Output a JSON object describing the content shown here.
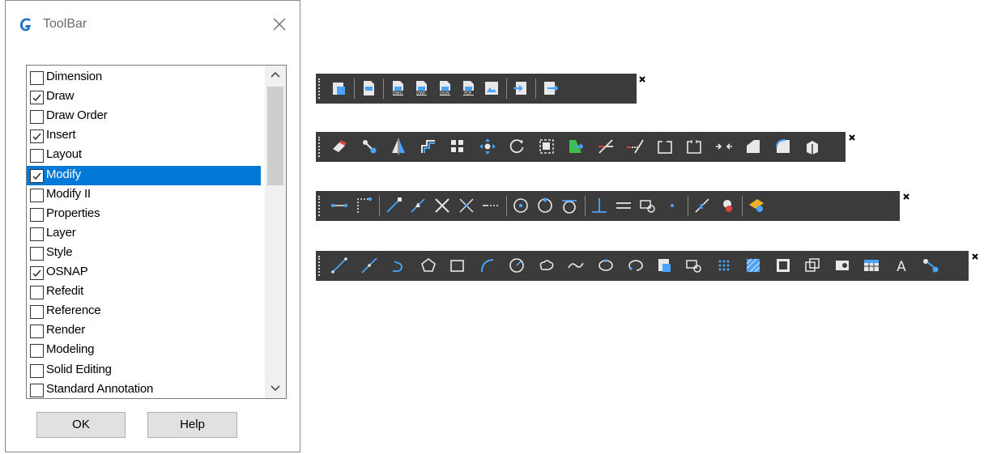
{
  "dialog": {
    "title": "ToolBar",
    "ok_label": "OK",
    "help_label": "Help",
    "items": [
      {
        "label": "Dimension",
        "checked": false,
        "selected": false
      },
      {
        "label": "Draw",
        "checked": true,
        "selected": false
      },
      {
        "label": "Draw Order",
        "checked": false,
        "selected": false
      },
      {
        "label": "Insert",
        "checked": true,
        "selected": false
      },
      {
        "label": "Layout",
        "checked": false,
        "selected": false
      },
      {
        "label": "Modify",
        "checked": true,
        "selected": true
      },
      {
        "label": "Modify II",
        "checked": false,
        "selected": false
      },
      {
        "label": "Properties",
        "checked": false,
        "selected": false
      },
      {
        "label": "Layer",
        "checked": false,
        "selected": false
      },
      {
        "label": "Style",
        "checked": false,
        "selected": false
      },
      {
        "label": "OSNAP",
        "checked": true,
        "selected": false
      },
      {
        "label": "Refedit",
        "checked": false,
        "selected": false
      },
      {
        "label": "Reference",
        "checked": false,
        "selected": false
      },
      {
        "label": "Render",
        "checked": false,
        "selected": false
      },
      {
        "label": "Modeling",
        "checked": false,
        "selected": false
      },
      {
        "label": "Solid Editing",
        "checked": false,
        "selected": false
      },
      {
        "label": "Standard Annotation",
        "checked": false,
        "selected": false
      }
    ]
  },
  "colors": {
    "selection": "#0078d7",
    "toolbar_bg": "#3b3b3b",
    "icon_blue": "#4aa3ff",
    "icon_white": "#e8e8e8",
    "icon_red": "#e0453a",
    "icon_green": "#3fbf4f",
    "icon_yellow": "#f0b323"
  },
  "toolbars": [
    {
      "name": "insert-toolbar",
      "icons": [
        "block-insert-icon",
        "|",
        "attach-xref-icon",
        "|",
        "attach-dwg-icon",
        "attach-dwf-icon",
        "attach-dgn-icon",
        "attach-pdf-icon",
        "attach-image-icon",
        "|",
        "import-icon",
        "|",
        "export-icon"
      ]
    },
    {
      "name": "modify-toolbar",
      "icons": [
        "erase-icon",
        "copy-icon",
        "mirror-icon",
        "offset-icon",
        "array-icon",
        "move-icon",
        "rotate-icon",
        "scale-icon",
        "stretch-icon",
        "trim-icon",
        "extend-icon",
        "break-at-point-icon",
        "break-icon",
        "join-icon",
        "chamfer-icon",
        "fillet-icon",
        "explode-icon"
      ]
    },
    {
      "name": "osnap-toolbar",
      "icons": [
        "temp-track-icon",
        "snap-from-icon",
        "|",
        "endpoint-icon",
        "midpoint-icon",
        "intersection-icon",
        "apparent-intersection-icon",
        "extension-icon",
        "|",
        "center-icon",
        "quadrant-icon",
        "tangent-icon",
        "|",
        "perpendicular-icon",
        "parallel-icon",
        "insertion-icon",
        "node-icon",
        "|",
        "nearest-icon",
        "none-icon",
        "|",
        "osnap-settings-icon"
      ]
    },
    {
      "name": "draw-toolbar",
      "icons": [
        "line-icon",
        "xline-icon",
        "polyline-icon",
        "polygon-icon",
        "rectangle-icon",
        "arc-icon",
        "circle-icon",
        "revcloud-icon",
        "spline-icon",
        "ellipse-icon",
        "ellipse-arc-icon",
        "insert-block-icon",
        "make-block-icon",
        "point-icon",
        "hatch-icon",
        "gradient-icon",
        "region-icon",
        "wipeout-icon",
        "table-icon",
        "mtext-icon",
        "add-selected-icon"
      ]
    }
  ]
}
